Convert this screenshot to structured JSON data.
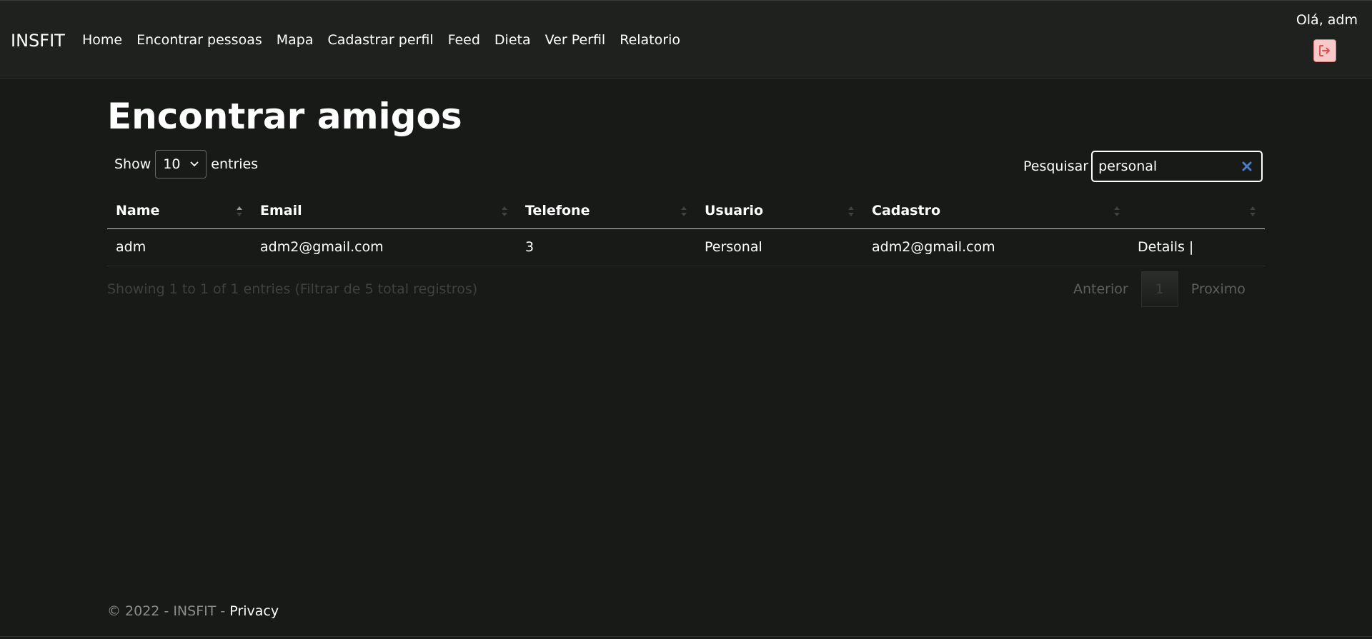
{
  "navbar": {
    "brand": "INSFIT",
    "links": [
      "Home",
      "Encontrar pessoas",
      "Mapa",
      "Cadastrar perfil",
      "Feed",
      "Dieta",
      "Ver Perfil",
      "Relatorio"
    ],
    "greeting": "Olá, adm",
    "logout_icon": "logout-icon"
  },
  "page": {
    "title": "Encontrar amigos"
  },
  "length": {
    "show": "Show",
    "value": "10",
    "entries": "entries"
  },
  "search": {
    "label": "Pesquisar",
    "value": "personal",
    "clear_icon": "clear-icon"
  },
  "table": {
    "headers": [
      "Name",
      "Email",
      "Telefone",
      "Usuario",
      "Cadastro",
      ""
    ],
    "rows": [
      {
        "name": "adm",
        "email": "adm2@gmail.com",
        "telefone": "3",
        "usuario": "Personal",
        "cadastro": "adm2@gmail.com",
        "action": "Details |"
      }
    ]
  },
  "info": "Showing 1 to 1 of 1 entries (Filtrar de 5 total registros)",
  "pagination": {
    "previous": "Anterior",
    "current": "1",
    "next": "Proximo"
  },
  "footer": {
    "copyright": "© 2022 - INSFIT - ",
    "privacy": "Privacy"
  },
  "colors": {
    "background": "#181a18",
    "navbar": "#1e211e",
    "logout_bg": "#f7c9c9",
    "logout_fg": "#d9534f",
    "clear_icon": "#4a7cc9"
  }
}
